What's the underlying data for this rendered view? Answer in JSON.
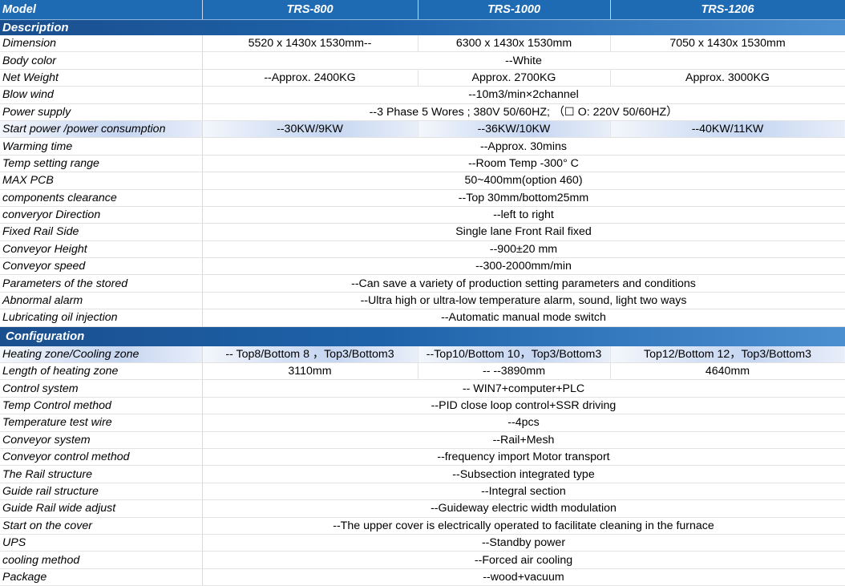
{
  "header": {
    "model_label": "Model",
    "models": [
      "TRS-800",
      "TRS-1000",
      "TRS-1206"
    ]
  },
  "sections": {
    "description": "Description",
    "configuration": "Configuration"
  },
  "description_rows": [
    {
      "label": "Dimension",
      "values": [
        "5520 x 1430x 1530mm--",
        "6300 x 1430x 1530mm",
        "7050 x 1430x 1530mm"
      ]
    },
    {
      "label": "Body color",
      "value": "--White"
    },
    {
      "label": "Net Weight",
      "values": [
        "--Approx.  2400KG",
        "Approx.  2700KG",
        "Approx.  3000KG"
      ]
    },
    {
      "label": "Blow wind",
      "value": "--10m3/min×2channel"
    },
    {
      "label": "Power supply",
      "value": "--3 Phase 5 Wores ; 380V 50/60HZ;  （☐ O: 220V 50/60HZ）"
    },
    {
      "label": "Start power /power consumption",
      "values": [
        "--30KW/9KW",
        "--36KW/10KW",
        "--40KW/11KW"
      ]
    },
    {
      "label": "Warming time",
      "value": "--Approx. 30mins"
    },
    {
      "label": "Temp setting range",
      "value": "--Room Temp -300° C"
    },
    {
      "label": "MAX PCB",
      "value": "50~400mm(option 460)"
    },
    {
      "label": "components clearance",
      "value": "--Top 30mm/bottom25mm"
    },
    {
      "label": "converyor Direction",
      "value": "--left to right"
    },
    {
      "label": "Fixed Rail Side",
      "value": "Single lane Front Rail fixed"
    },
    {
      "label": "Conveyor Height",
      "value": "--900±20 mm"
    },
    {
      "label": "Conveyor speed",
      "value": "--300-2000mm/min"
    },
    {
      "label": "Parameters of the stored",
      "value": "--Can save a variety of production setting parameters and conditions"
    },
    {
      "label": "Abnormal alarm",
      "value": "--Ultra high or ultra-low temperature alarm, sound, light two ways"
    },
    {
      "label": "Lubricating oil injection",
      "value": "--Automatic manual mode switch"
    }
  ],
  "configuration_rows": [
    {
      "label": "Heating zone/Cooling zone",
      "values": [
        "-- Top8/Bottom 8 ，Top3/Bottom3",
        "--Top10/Bottom 10，Top3/Bottom3",
        "Top12/Bottom 12，Top3/Bottom3"
      ]
    },
    {
      "label": "Length of heating zone",
      "values": [
        "3110mm",
        "-- --3890mm",
        "4640mm"
      ]
    },
    {
      "label": "Control system",
      "value": "--  WIN7+computer+PLC"
    },
    {
      "label": "Temp Control method",
      "value": "--PID close loop control+SSR driving"
    },
    {
      "label": "Temperature test wire",
      "value": "--4pcs"
    },
    {
      "label": "Conveyor system",
      "value": "--Rail+Mesh"
    },
    {
      "label": "Conveyor control method",
      "value": "--frequency import Motor transport"
    },
    {
      "label": "The  Rail structure",
      "value": "--Subsection integrated  type"
    },
    {
      "label": "Guide rail structure",
      "value": "--Integral section"
    },
    {
      "label": "Guide Rail wide adjust",
      "value": "--Guideway electric width modulation"
    },
    {
      "label": "Start on the cover",
      "value": "--The upper cover is electrically operated to facilitate cleaning in the furnace"
    },
    {
      "label": "UPS",
      "value": "--Standby power"
    },
    {
      "label": "cooling method",
      "value": "--Forced air cooling"
    },
    {
      "label": "Package",
      "value": "--wood+vacuum"
    }
  ]
}
